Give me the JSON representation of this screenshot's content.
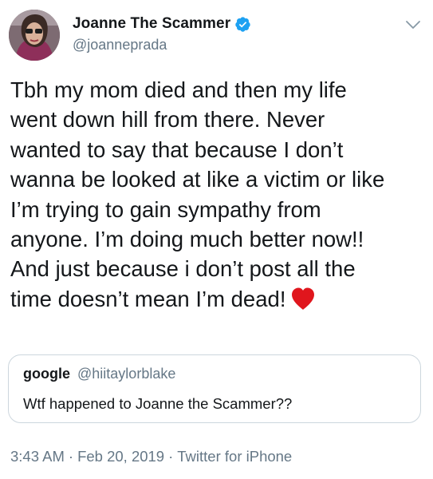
{
  "author": {
    "display_name": "Joanne The Scammer",
    "handle": "@joanneprada",
    "verified": true,
    "avatar_icon": "profile-avatar"
  },
  "tweet": {
    "lines": [
      "Tbh my mom died and then my life",
      "went down hill from there. Never",
      "wanted to say that because I don’t",
      "wanna be looked at like a victim or like",
      "I’m trying to gain sympathy from",
      "anyone. I’m doing much better now!!",
      "And just because i don’t post all the",
      "time doesn’t mean I’m dead!"
    ],
    "emoji": "red-heart-icon"
  },
  "quoted": {
    "name": "google",
    "handle": "@hiitaylorblake",
    "text": "Wtf happened to Joanne the Scammer??"
  },
  "meta": {
    "time": "3:43 AM",
    "separator": "·",
    "date": "Feb 20, 2019",
    "source": "Twitter for iPhone"
  },
  "colors": {
    "verified_badge": "#1da1f2",
    "secondary_text": "#657786",
    "heart": "#e0161d",
    "border": "#ccd6dd"
  }
}
